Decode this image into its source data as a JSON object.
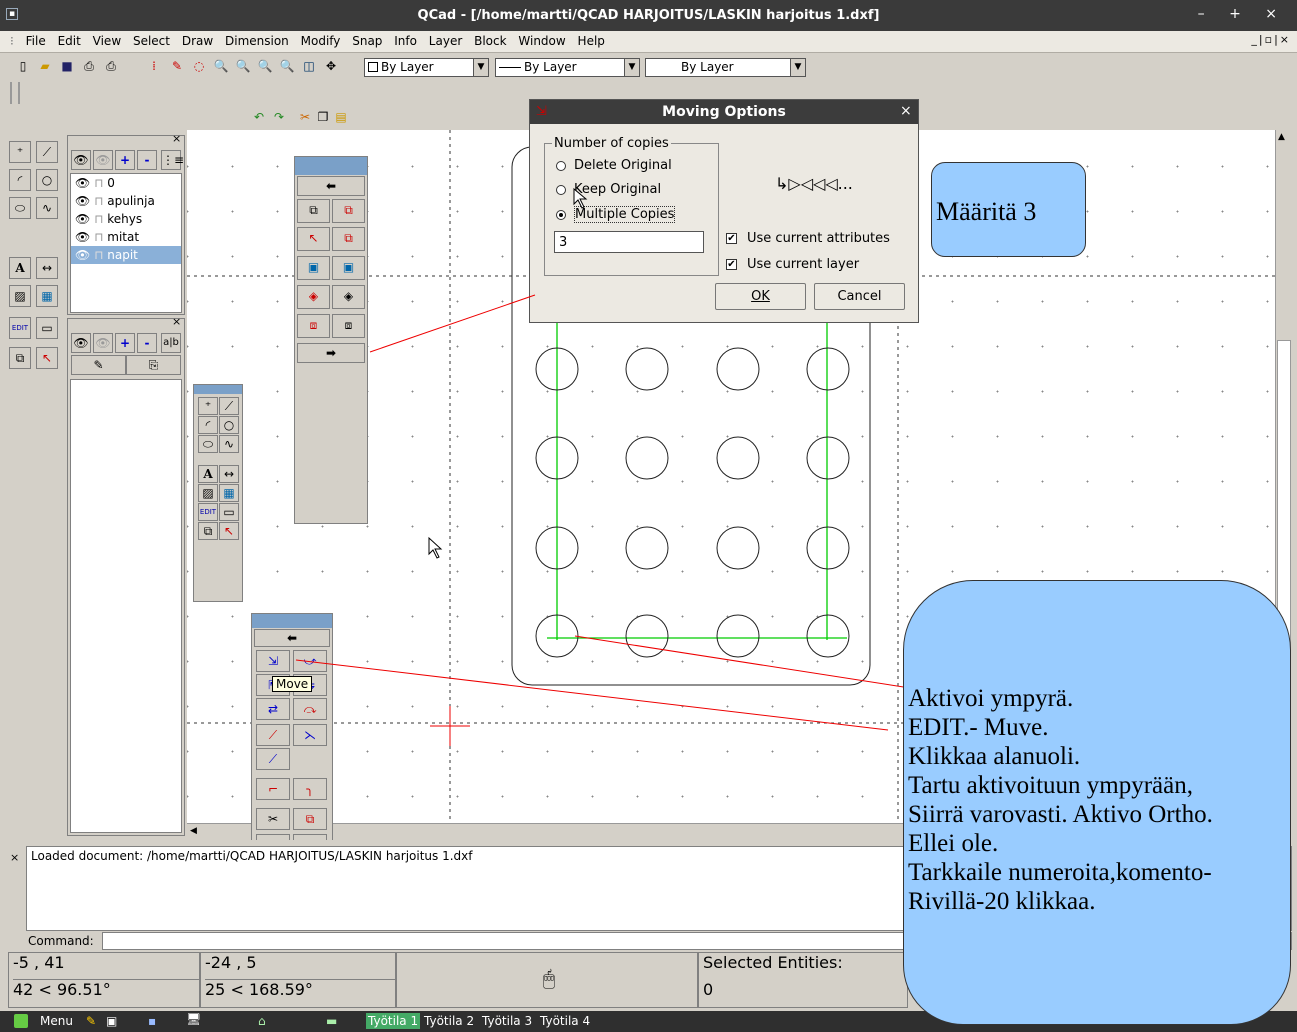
{
  "window": {
    "title": "QCad - [/home/martti/QCAD HARJOITUS/LASKIN harjoitus 1.dxf]",
    "controls": "– + ×"
  },
  "menu": {
    "items": [
      "File",
      "Edit",
      "View",
      "Select",
      "Draw",
      "Dimension",
      "Modify",
      "Snap",
      "Info",
      "Layer",
      "Block",
      "Window",
      "Help"
    ],
    "mdi_controls": "_|▫|×"
  },
  "toolbar": {
    "color_combo": "By Layer",
    "linetype_combo": "By Layer",
    "width_combo": "By Layer"
  },
  "layers": {
    "items": [
      {
        "name": "0",
        "selected": false
      },
      {
        "name": "apulinja",
        "selected": false
      },
      {
        "name": "kehys",
        "selected": false
      },
      {
        "name": "mitat",
        "selected": false
      },
      {
        "name": "napit",
        "selected": true
      }
    ]
  },
  "block_panel": {
    "abc_label": "a|b"
  },
  "dialog": {
    "title": "Moving Options",
    "group_label": "Number of copies",
    "radio_delete": "Delete Original",
    "radio_keep": "Keep Original",
    "radio_multiple": "Multiple Copies",
    "copies_value": "3",
    "preview_text": "↳▷◁◁◁...",
    "check_attributes": "Use current attributes",
    "check_layer": "Use current layer",
    "ok_label": "OK",
    "cancel_label": "Cancel"
  },
  "tooltip": "Move",
  "command": {
    "history_line": "Loaded document: /home/martti/QCAD HARJOITUS/LASKIN harjoitus 1.dxf",
    "prompt_label": "Command:"
  },
  "status": {
    "abs_coord": "-5 , 41",
    "abs_polar": "42 < 96.51°",
    "rel_coord": "-24 , 5",
    "rel_polar": "25 < 168.59°",
    "selected_label": "Selected Entities:",
    "selected_count": "0"
  },
  "taskbar": {
    "menu_label": "Menu",
    "workspaces": [
      "Työtila 1",
      "Työtila 2",
      "Työtila 3",
      "Työtila 4"
    ]
  },
  "annotations": {
    "callout_top": "Määritä 3",
    "callout_lines": [
      "Aktivoi ympyrä.",
      "EDIT.- Muve.",
      "Klikkaa alanuoli.",
      "Tartu aktivoituun ympyrään,",
      "Siirrä varovasti. Aktivo Ortho.",
      "Ellei ole.",
      "Tarkkaile numeroita,komento-",
      "Rivillä-20 klikkaa."
    ]
  }
}
